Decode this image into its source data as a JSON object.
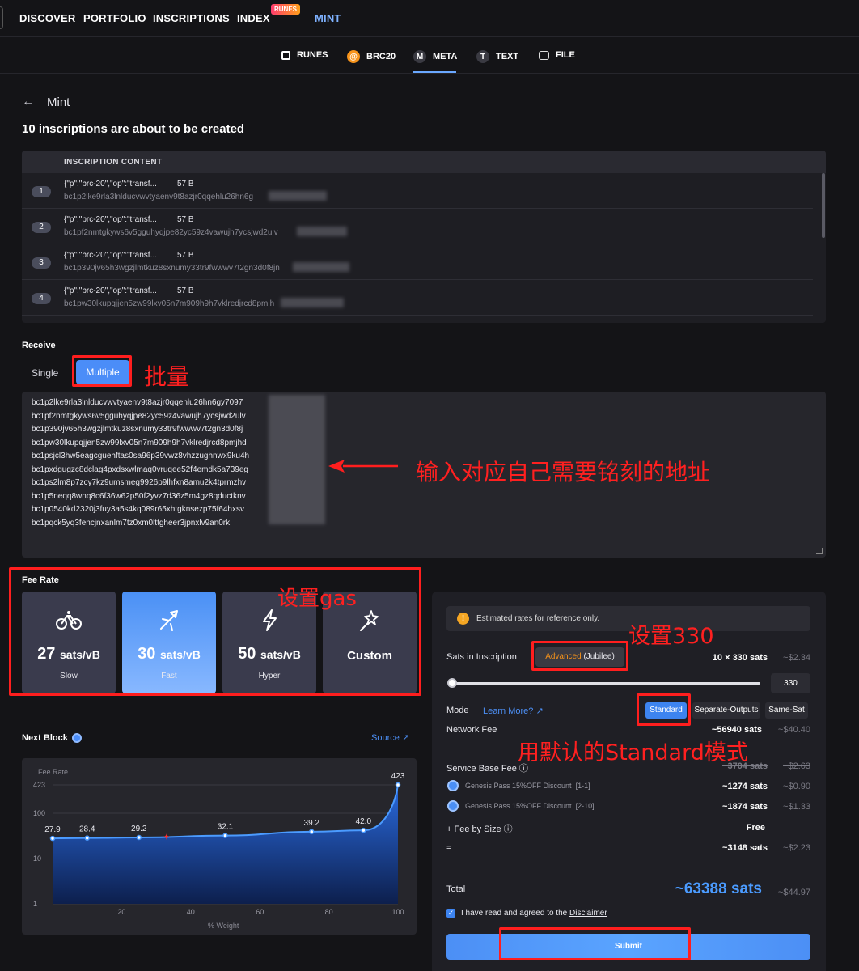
{
  "nav": {
    "items": [
      "DISCOVER",
      "PORTFOLIO",
      "INSCRIPTIONS",
      "INDEX",
      "MINT"
    ],
    "badge": "RUNES",
    "active": "MINT"
  },
  "subtabs": [
    "RUNES",
    "BRC20",
    "META",
    "TEXT",
    "FILE"
  ],
  "subtab_icons": {
    "brc": "@",
    "meta": "M",
    "text": "T"
  },
  "page": {
    "back_icon": "←",
    "title": "Mint",
    "headline": "10 inscriptions are about to be created"
  },
  "inscriptions": {
    "header": "INSCRIPTION CONTENT",
    "rows": [
      {
        "num": "1",
        "content": "{\"p\":\"brc-20\",\"op\":\"transf...",
        "size": "57 B",
        "addr": "bc1p2lke9rla3lnlducvwvtyaenv9t8azjr0qqehlu26hn6g"
      },
      {
        "num": "2",
        "content": "{\"p\":\"brc-20\",\"op\":\"transf...",
        "size": "57 B",
        "addr": "bc1pf2nmtgkyws6v5gguhyqjpe82yc59z4vawujh7ycsjwd2ulv"
      },
      {
        "num": "3",
        "content": "{\"p\":\"brc-20\",\"op\":\"transf...",
        "size": "57 B",
        "addr": "bc1p390jv65h3wgzjlmtkuz8sxnumy33tr9fwwwv7t2gn3d0f8jn"
      },
      {
        "num": "4",
        "content": "{\"p\":\"brc-20\",\"op\":\"transf...",
        "size": "57 B",
        "addr": "bc1pw30lkupqjjen5zw99lxv05n7m909h9h7vklredjrcd8pmjh"
      }
    ]
  },
  "receive": {
    "label": "Receive",
    "single": "Single",
    "multiple": "Multiple",
    "addresses": [
      "bc1p2lke9rla3lnlducvwvtyaenv9t8azjr0qqehlu26hn6gy7097",
      "bc1pf2nmtgkyws6v5gguhyqjpe82yc59z4vawujh7ycsjwd2ulv",
      "bc1p390jv65h3wgzjlmtkuz8sxnumy33tr9fwwwv7t2gn3d0f8j",
      "bc1pw30lkupqjjen5zw99lxv05n7m909h9h7vklredjrcd8pmjhd",
      "bc1psjcl3hw5eagcguehftas0sa96p39vwz8vhzzughnwx9ku4h",
      "bc1pxdgugzc8dclag4pxdsxwlmaq0vruqee52f4emdk5a739eg",
      "bc1ps2lm8p7zcy7kz9umsmeg9926p9lhfxn8amu2k4tprmzhv",
      "bc1p5neqq8wnq8c6f36w62p50f2yvz7d36z5m4gz8qductknv",
      "bc1p0540kd2320j3fuy3a5s4kq089r65xhtgknsezp75f64hxsv",
      "bc1pqck5yq3fencjnxanlm7tz0xm0lttgheer3jpnxlv9an0rk"
    ]
  },
  "fee_rate": {
    "label": "Fee Rate",
    "options": [
      {
        "value": "27",
        "unit": "sats/vB",
        "name": "Slow",
        "icon": "bicycle-icon"
      },
      {
        "value": "30",
        "unit": "sats/vB",
        "name": "Fast",
        "icon": "airplane-icon"
      },
      {
        "value": "50",
        "unit": "sats/vB",
        "name": "Hyper",
        "icon": "lightning-icon"
      },
      {
        "custom": "Custom",
        "icon": "magic-wand-icon"
      }
    ],
    "selected": "Fast"
  },
  "next_block": {
    "label": "Next Block",
    "source": "Source",
    "source_icon": "↗"
  },
  "chart_data": {
    "type": "area",
    "ylabel": "Fee Rate",
    "xlabel": "% Weight",
    "x": [
      0,
      10,
      25,
      50,
      75,
      90,
      100
    ],
    "values": [
      27.9,
      28.4,
      29.2,
      32.1,
      39.2,
      42.0,
      423
    ],
    "value_labels": [
      "27.9",
      "28.4",
      "29.2",
      "32.1",
      "39.2",
      "42.0",
      "423"
    ],
    "yscale": "log",
    "yticks": [
      "423",
      "100",
      "10",
      "1"
    ],
    "ytick_values": [
      423,
      100,
      10,
      1
    ],
    "xticks": [
      "20",
      "40",
      "60",
      "80",
      "100"
    ],
    "xtick_values": [
      20,
      40,
      60,
      80,
      100
    ],
    "xlim": [
      0,
      100
    ],
    "ylim": [
      1,
      423
    ],
    "marker_x": 33,
    "colors": {
      "line": "#4b9bff",
      "fill_top": "#2a6be0",
      "fill_bottom": "#0d1f4d",
      "marker": "#ff2d2d"
    }
  },
  "summary": {
    "note": "Estimated rates for reference only.",
    "note_icon": "!",
    "sats_label": "Sats in Inscription",
    "advanced": "Advanced",
    "jubilee": "(Jubilee)",
    "sats_value": "10 × 330 sats",
    "sats_usd": "~$2.34",
    "slider_value": "330",
    "mode_label": "Mode",
    "learn_more": "Learn More?",
    "learn_icon": "↗",
    "modes": [
      "Standard",
      "Separate-Outputs",
      "Same-Sat"
    ],
    "mode_selected": "Standard",
    "network_label": "Network Fee",
    "network_value": "~56940 sats",
    "network_usd": "~$40.40",
    "service_label": "Service Base Fee",
    "service_info_icon": "ⓘ",
    "service_value": "~3704 sats",
    "service_usd": "~$2.63",
    "gp1_label": "Genesis Pass 15%OFF Discount",
    "gp1_range": "[1-1]",
    "gp1_value": "~1274 sats",
    "gp1_usd": "~$0.90",
    "gp2_label": "Genesis Pass 15%OFF Discount",
    "gp2_range": "[2-10]",
    "gp2_value": "~1874 sats",
    "gp2_usd": "~$1.33",
    "size_label": "+ Fee by Size",
    "size_value": "Free",
    "eq_label": "=",
    "eq_value": "~3148 sats",
    "eq_usd": "~$2.23",
    "total_label": "Total",
    "total_value": "~63388 sats",
    "total_usd": "~$44.97",
    "agree_pre": "I have read and agreed to the",
    "agree_link": "Disclaimer",
    "submit": "Submit"
  },
  "annotations": {
    "multiple": "批量",
    "addresses": "输入对应自己需要铭刻的地址",
    "gas": "设置gas",
    "sats": "设置330",
    "mode": "用默认的Standard模式"
  },
  "colors": {
    "accent": "#4b8df8",
    "annotation": "#ff1e1e",
    "bitcoin": "#f7931a"
  }
}
